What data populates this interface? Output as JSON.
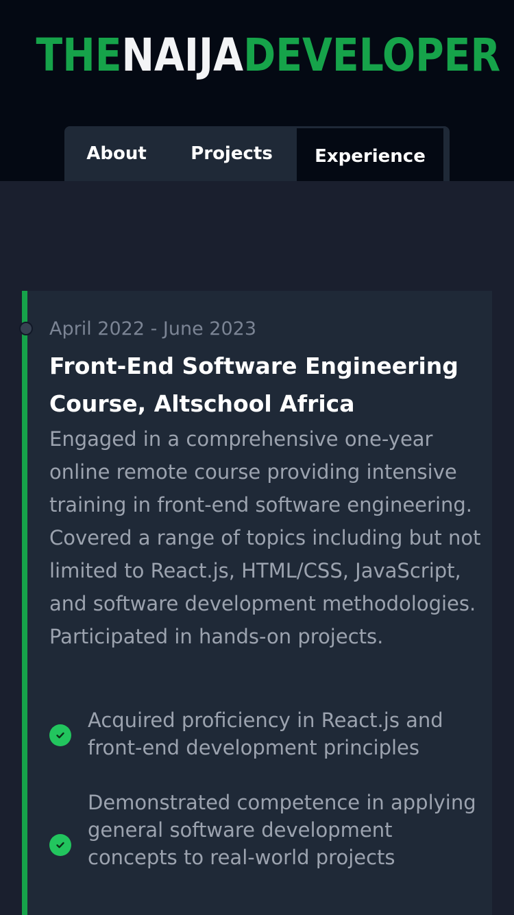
{
  "logo": {
    "part1": "THE",
    "part2": "NAIJA",
    "part3": "DEVELOPER"
  },
  "tabs": [
    {
      "label": "About"
    },
    {
      "label": "Projects"
    },
    {
      "label": "Experience",
      "active": true
    }
  ],
  "experience": {
    "date": "April 2022 - June 2023",
    "title": "Front-End Software Engineering Course, Altschool Africa",
    "description": "Engaged in a comprehensive one-year online remote course providing intensive training in front-end software engineering. Covered a range of topics including but not limited to React.js, HTML/CSS, JavaScript, and software development methodologies. Participated in hands-on projects.",
    "highlights": [
      "Acquired proficiency in React.js and front-end development principles",
      "Demonstrated competence in applying general software development concepts to real-world projects"
    ]
  },
  "colors": {
    "accent": "#16a34a",
    "check": "#22c55e",
    "background": "#1a1f2e",
    "header": "#040913",
    "card": "#1f2937"
  },
  "icons": {
    "check": "check-circle-icon",
    "timeline": "timeline-dot-icon"
  }
}
